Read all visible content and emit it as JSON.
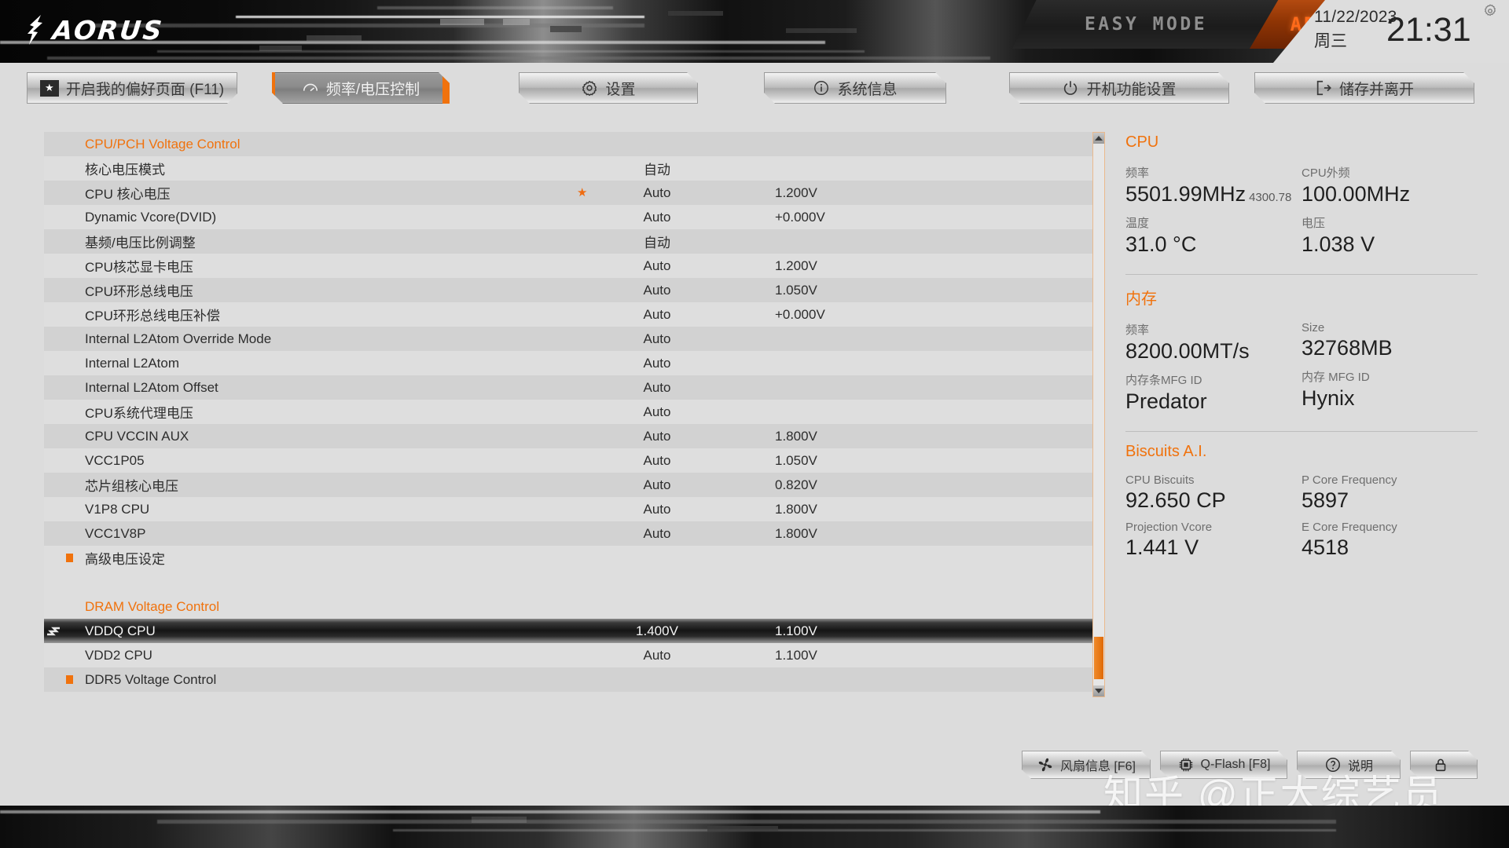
{
  "header": {
    "brand": "AORUS",
    "mode_easy": "EASY MODE",
    "mode_advanced": "ADVANCED MODE",
    "date": "11/22/2023",
    "weekday": "周三",
    "time": "21:31",
    "gear_icon": "gear-icon"
  },
  "nav": {
    "tabs": [
      {
        "label": "开启我的偏好页面 (F11)",
        "icon": "star-badge-icon",
        "active": false
      },
      {
        "label": "频率/电压控制",
        "icon": "gauge-icon",
        "active": true
      },
      {
        "label": "设置",
        "icon": "gear-icon",
        "active": false
      },
      {
        "label": "系统信息",
        "icon": "info-icon",
        "active": false
      },
      {
        "label": "开机功能设置",
        "icon": "power-icon",
        "active": false
      },
      {
        "label": "储存并离开",
        "icon": "exit-icon",
        "active": false
      }
    ]
  },
  "settings": {
    "rows": [
      {
        "type": "header",
        "label": "CPU/PCH Voltage Control"
      },
      {
        "type": "item",
        "label": "核心电压模式",
        "value": "自动",
        "value2": ""
      },
      {
        "type": "item",
        "label": "CPU 核心电压",
        "value": "Auto",
        "value2": "1.200V",
        "star": true
      },
      {
        "type": "item",
        "label": "Dynamic Vcore(DVID)",
        "value": "Auto",
        "value2": "+0.000V"
      },
      {
        "type": "item",
        "label": "基频/电压比例调整",
        "value": "自动",
        "value2": ""
      },
      {
        "type": "item",
        "label": "CPU核芯显卡电压",
        "value": "Auto",
        "value2": "1.200V"
      },
      {
        "type": "item",
        "label": "CPU环形总线电压",
        "value": "Auto",
        "value2": "1.050V"
      },
      {
        "type": "item",
        "label": "CPU环形总线电压补偿",
        "value": "Auto",
        "value2": "+0.000V"
      },
      {
        "type": "item",
        "label": "Internal L2Atom Override Mode",
        "value": "Auto",
        "value2": ""
      },
      {
        "type": "item",
        "label": "Internal L2Atom",
        "value": "Auto",
        "value2": ""
      },
      {
        "type": "item",
        "label": "Internal L2Atom Offset",
        "value": "Auto",
        "value2": ""
      },
      {
        "type": "item",
        "label": "CPU系统代理电压",
        "value": "Auto",
        "value2": ""
      },
      {
        "type": "item",
        "label": "CPU VCCIN AUX",
        "value": "Auto",
        "value2": "1.800V"
      },
      {
        "type": "item",
        "label": "VCC1P05",
        "value": "Auto",
        "value2": "1.050V"
      },
      {
        "type": "item",
        "label": "芯片组核心电压",
        "value": "Auto",
        "value2": "0.820V"
      },
      {
        "type": "item",
        "label": "V1P8 CPU",
        "value": "Auto",
        "value2": "1.800V"
      },
      {
        "type": "item",
        "label": "VCC1V8P",
        "value": "Auto",
        "value2": "1.800V"
      },
      {
        "type": "submenu",
        "label": "高级电压设定",
        "value": "",
        "value2": ""
      },
      {
        "type": "spacer",
        "label": "",
        "value": "",
        "value2": ""
      },
      {
        "type": "header",
        "label": "DRAM Voltage Control"
      },
      {
        "type": "item",
        "label": "VDDQ CPU",
        "value": "1.400V",
        "value2": "1.100V",
        "selected": true
      },
      {
        "type": "item",
        "label": "VDD2 CPU",
        "value": "Auto",
        "value2": "1.100V"
      },
      {
        "type": "submenu",
        "label": "DDR5 Voltage Control",
        "value": "",
        "value2": ""
      }
    ]
  },
  "info": {
    "cpu": {
      "title": "CPU",
      "freq_label": "频率",
      "freq_value": "5501.99MHz",
      "freq_sub": "4300.78",
      "bclk_label": "CPU外频",
      "bclk_value": "100.00MHz",
      "temp_label": "温度",
      "temp_value": "31.0 °C",
      "volt_label": "电压",
      "volt_value": "1.038 V"
    },
    "memory": {
      "title": "内存",
      "freq_label": "频率",
      "freq_value": "8200.00MT/s",
      "size_label": "Size",
      "size_value": "32768MB",
      "mfg1_label": "内存条MFG ID",
      "mfg1_value": "Predator",
      "mfg2_label": "内存 MFG ID",
      "mfg2_value": "Hynix"
    },
    "biscuits": {
      "title": "Biscuits A.I.",
      "cpu_biscuits_label": "CPU Biscuits",
      "cpu_biscuits_value": "92.650 CP",
      "p_core_label": "P Core Frequency",
      "p_core_value": "5897",
      "proj_vcore_label": "Projection Vcore",
      "proj_vcore_value": "1.441 V",
      "e_core_label": "E Core Frequency",
      "e_core_value": "4518"
    }
  },
  "footer": {
    "buttons": [
      {
        "label": "风扇信息 [F6]",
        "icon": "fan-icon"
      },
      {
        "label": "Q-Flash [F8]",
        "icon": "chip-icon"
      },
      {
        "label": "说明",
        "icon": "question-icon"
      },
      {
        "label": "",
        "icon": "lock-icon"
      }
    ],
    "watermark": "知乎 @正大综艺员"
  },
  "colors": {
    "accent": "#f0720d",
    "panel_bg": "#dcdcdc",
    "row_odd": "#d2d2d2",
    "row_even": "#dedede"
  }
}
